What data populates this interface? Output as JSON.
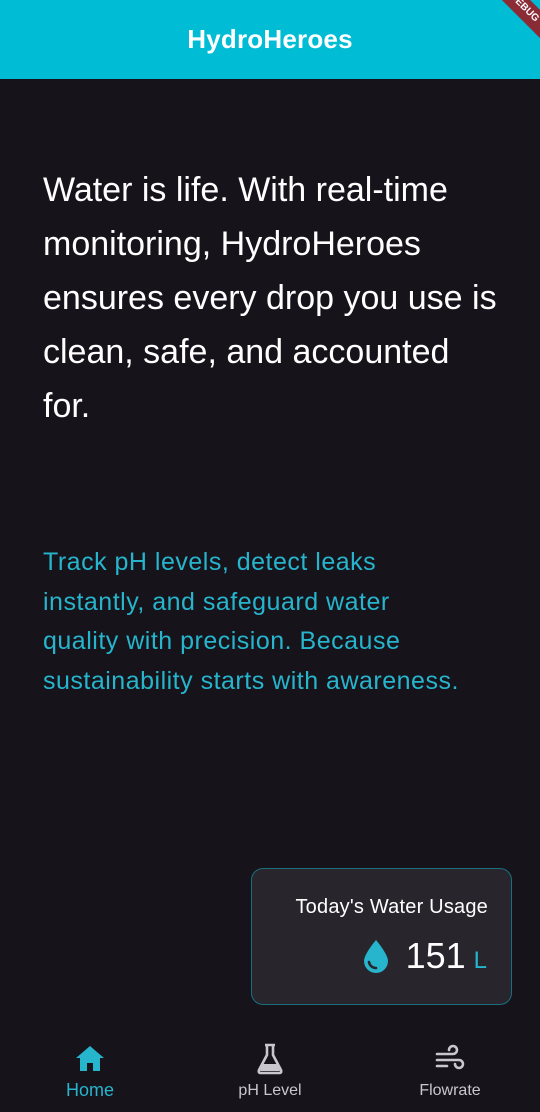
{
  "app": {
    "title": "HydroHeroes",
    "debug_banner": "DEBUG"
  },
  "main": {
    "headline": "Water is life. With real-time monitoring, HydroHeroes ensures every drop you use is clean, safe, and accounted for.",
    "subtext": "Track pH levels, detect leaks instantly, and safeguard water quality with precision. Because sustainability starts with awareness."
  },
  "usage_card": {
    "title": "Today's Water Usage",
    "value": "151",
    "unit": "L",
    "icon": "water-drop-icon"
  },
  "nav": {
    "items": [
      {
        "label": "Home",
        "icon": "home-icon",
        "active": true
      },
      {
        "label": "pH Level",
        "icon": "flask-icon",
        "active": false
      },
      {
        "label": "Flowrate",
        "icon": "wind-icon",
        "active": false
      }
    ]
  },
  "colors": {
    "accent": "#00bcd4",
    "accent_text": "#26b5cc",
    "background": "#16131b",
    "card": "#28252d",
    "debug_ribbon": "#8b2b35"
  }
}
